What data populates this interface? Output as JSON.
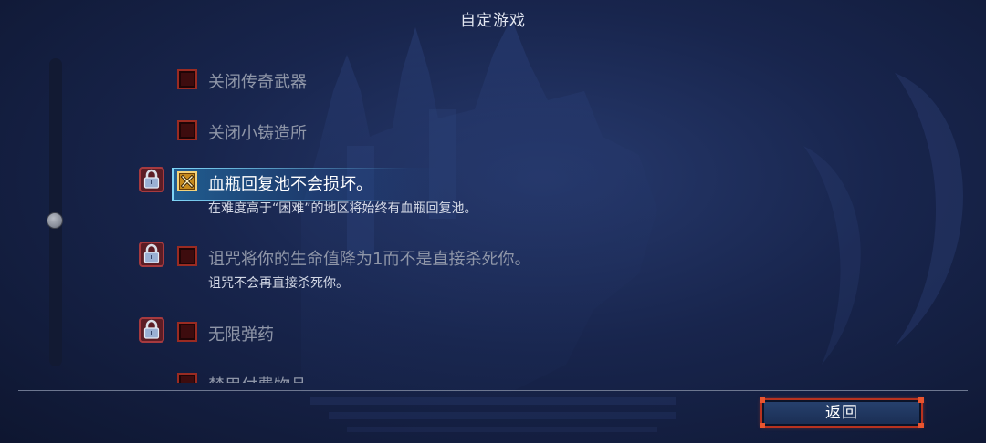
{
  "header": {
    "title": "自定游戏"
  },
  "options": [
    {
      "label": "关闭传奇武器",
      "description": "",
      "checked": false,
      "locked": false,
      "selected": false
    },
    {
      "label": "关闭小铸造所",
      "description": "",
      "checked": false,
      "locked": false,
      "selected": false
    },
    {
      "label": "血瓶回复池不会损坏。",
      "description": "在难度高于“困难”的地区将始终有血瓶回复池。",
      "checked": true,
      "locked": true,
      "selected": true
    },
    {
      "label": "诅咒将你的生命值降为1而不是直接杀死你。",
      "description": "诅咒不会再直接杀死你。",
      "checked": false,
      "locked": true,
      "selected": false
    },
    {
      "label": "无限弹药",
      "description": "",
      "checked": false,
      "locked": true,
      "selected": false
    },
    {
      "label": "禁用付费物品",
      "description": "",
      "checked": false,
      "locked": false,
      "selected": false
    }
  ],
  "footer": {
    "back_label": "返回"
  },
  "colors": {
    "checkbox_unchecked": "#3d0c0e",
    "checkbox_checked": "#c58a1e",
    "highlight": "#7fd4f6",
    "button_border": "#b8321f"
  },
  "icons": {
    "lock": "padlock-icon",
    "check": "x-mark-icon"
  }
}
